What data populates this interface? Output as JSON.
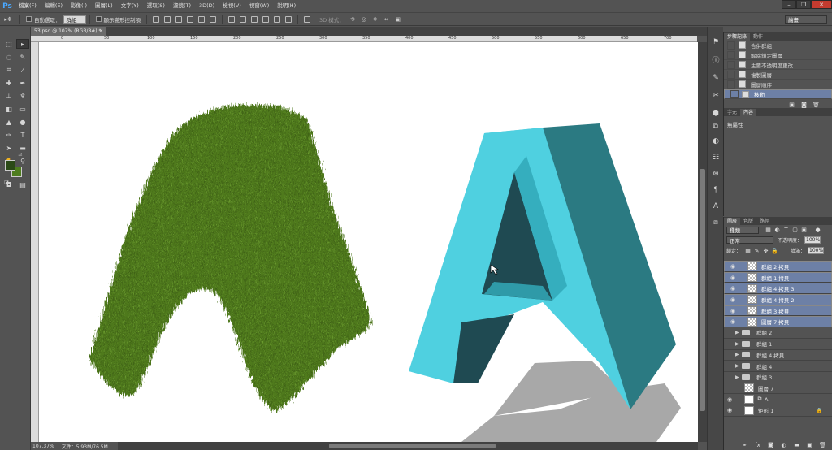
{
  "app": {
    "logo": "Ps",
    "brand_color": "#4aa8ff"
  },
  "menu": [
    "檔案(F)",
    "編輯(E)",
    "影像(I)",
    "圖層(L)",
    "文字(Y)",
    "選取(S)",
    "濾鏡(T)",
    "3D(D)",
    "檢視(V)",
    "視窗(W)",
    "說明(H)"
  ],
  "window_controls": {
    "minimize": "–",
    "restore": "❐",
    "close": "✕"
  },
  "options": {
    "auto_select_label": "自動選取：",
    "auto_select_value": "群組",
    "transform_label": "顯示變形控制項",
    "mode3d_label": "3D 模式：",
    "workspace": "繪畫"
  },
  "document": {
    "tab_title": "53.psd @ 107% (RGB/8#) *",
    "zoom": "107.37%",
    "file_info": "文件：5.93M/76.5M",
    "ruler_marks": [
      "0",
      "50",
      "100",
      "150",
      "200",
      "250",
      "300",
      "350",
      "400",
      "450",
      "500",
      "550",
      "600",
      "650",
      "700",
      "750"
    ]
  },
  "history": {
    "tabs": [
      "步驟記錄",
      "動作"
    ],
    "items": [
      {
        "label": "合併群組",
        "selected": false
      },
      {
        "label": "解除鎖定圖層",
        "selected": false
      },
      {
        "label": "主要不透明度更改",
        "selected": false
      },
      {
        "label": "複製圖層",
        "selected": false
      },
      {
        "label": "圖層順序",
        "selected": false
      },
      {
        "label": "移動",
        "selected": true
      }
    ]
  },
  "properties": {
    "tabs": [
      "字元",
      "內容"
    ],
    "empty_text": "無屬性"
  },
  "layers_panel": {
    "tabs": [
      "圖層",
      "色版",
      "路徑"
    ],
    "filter_kind": "種類",
    "blend_mode": "正常",
    "opacity_label": "不透明度：",
    "opacity_value": "100%",
    "lock_label": "鎖定：",
    "fill_label": "填滿：",
    "fill_value": "100%",
    "layers": [
      {
        "name": "群組 2 拷貝",
        "type": "raster",
        "selected": true,
        "visible": true
      },
      {
        "name": "群組 1 拷貝",
        "type": "raster",
        "selected": true,
        "visible": true
      },
      {
        "name": "群組 4 拷貝 3",
        "type": "raster",
        "selected": true,
        "visible": true
      },
      {
        "name": "群組 4 拷貝 2",
        "type": "raster",
        "selected": true,
        "visible": true
      },
      {
        "name": "群組 3 拷貝",
        "type": "raster",
        "selected": true,
        "visible": true
      },
      {
        "name": "圖層 7 拷貝",
        "type": "raster",
        "selected": true,
        "visible": true
      },
      {
        "name": "群組 2",
        "type": "group",
        "selected": false,
        "visible": false
      },
      {
        "name": "群組 1",
        "type": "group",
        "selected": false,
        "visible": false
      },
      {
        "name": "群組 4 拷貝",
        "type": "group",
        "selected": false,
        "visible": false
      },
      {
        "name": "群組 4",
        "type": "group",
        "selected": false,
        "visible": false
      },
      {
        "name": "群組 3",
        "type": "group",
        "selected": false,
        "visible": false
      },
      {
        "name": "圖層 7",
        "type": "raster",
        "selected": false,
        "visible": false
      },
      {
        "name": "A",
        "type": "smart",
        "selected": false,
        "visible": true
      },
      {
        "name": "矩形 1",
        "type": "shape",
        "selected": false,
        "visible": true,
        "locked": true
      }
    ]
  },
  "colors": {
    "foreground": "#2b4a17",
    "background": "#4e7d1e",
    "grass": "#4f7a1d",
    "cyan_face": "#4fd0e0",
    "cyan_side": "#2b7a82",
    "shadow": "#a8a8a8",
    "selection": "#6d80a6"
  }
}
